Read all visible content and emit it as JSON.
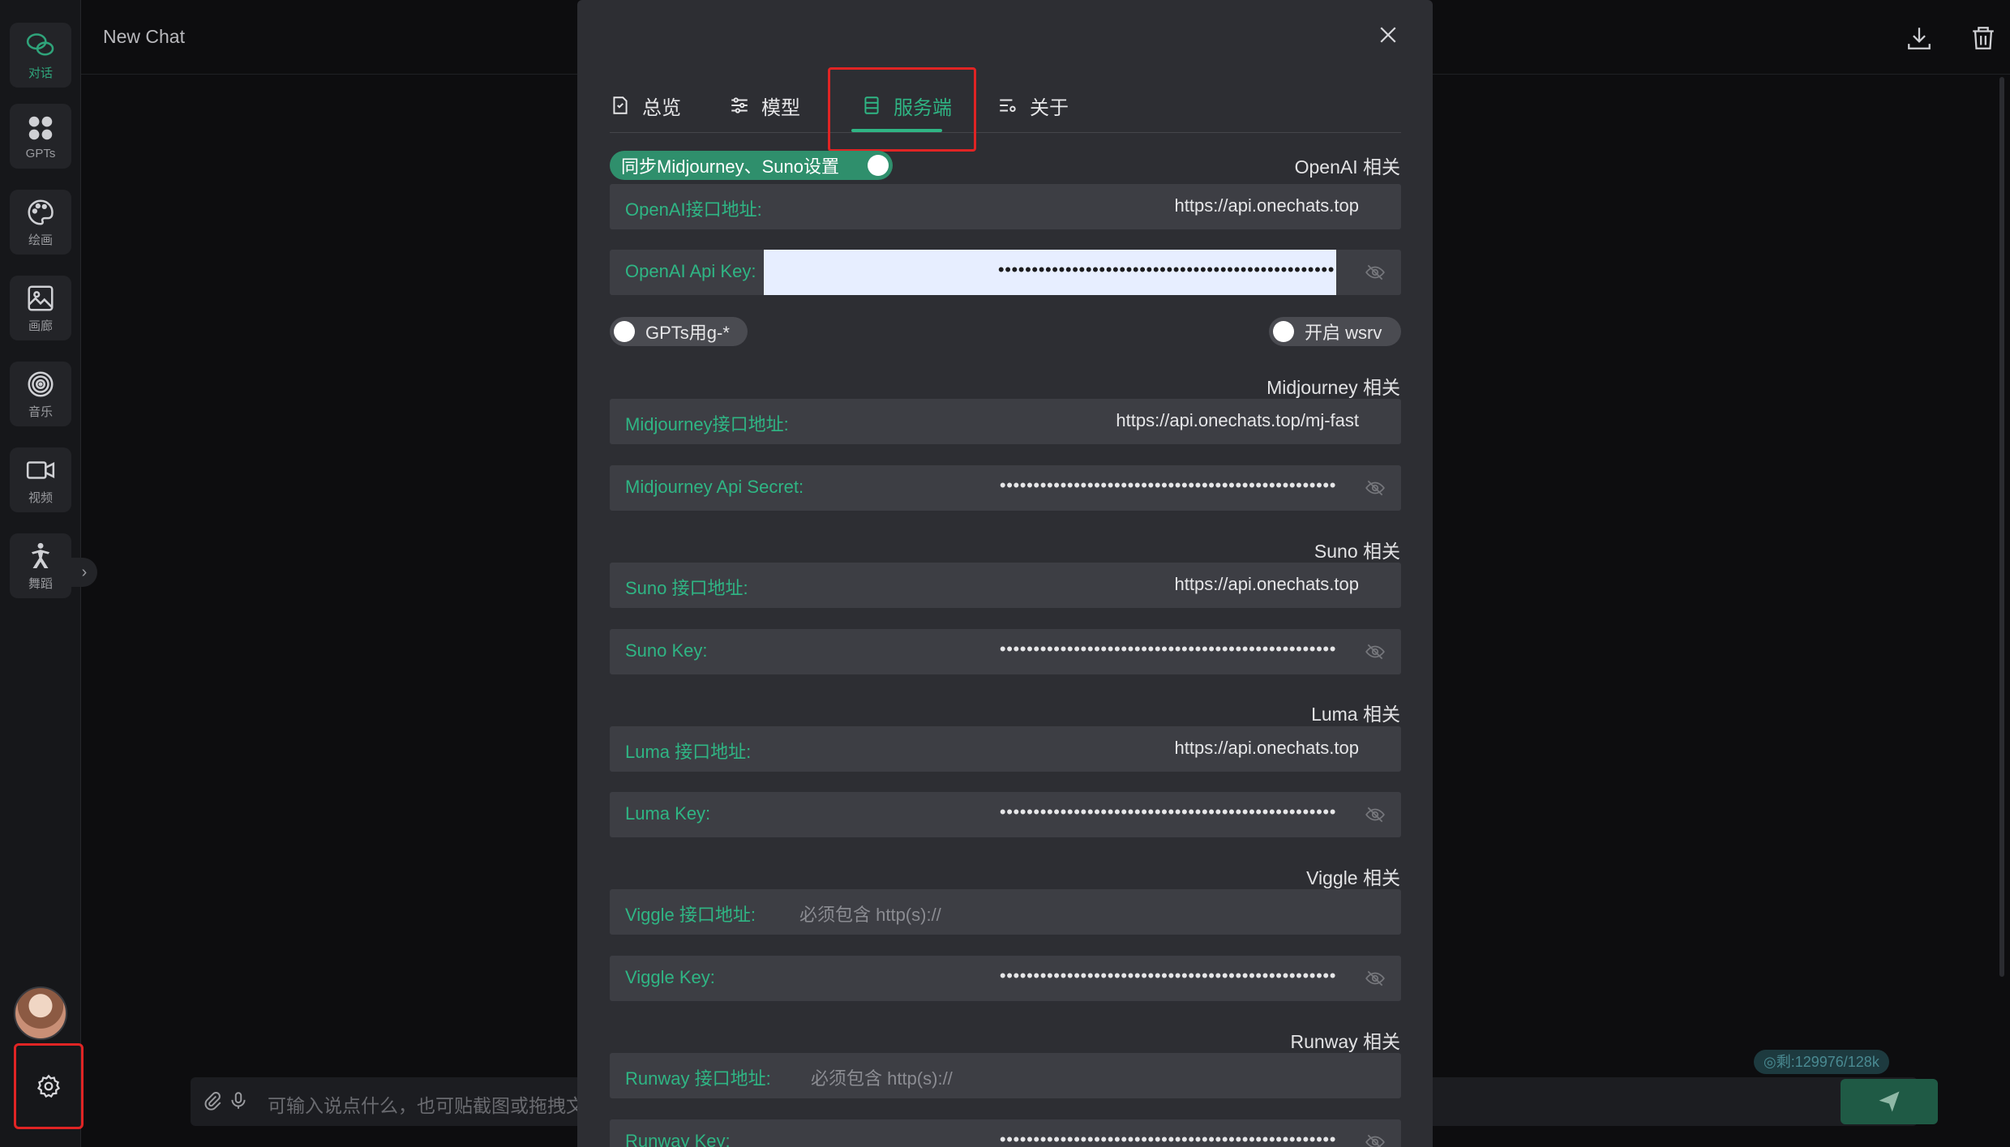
{
  "sidebar": {
    "items": [
      {
        "label": "对话",
        "icon": "chat-icon"
      },
      {
        "label": "GPTs",
        "icon": "apps-icon"
      },
      {
        "label": "绘画",
        "icon": "palette-icon"
      },
      {
        "label": "画廊",
        "icon": "gallery-icon"
      },
      {
        "label": "音乐",
        "icon": "music-icon"
      },
      {
        "label": "视频",
        "icon": "video-icon"
      },
      {
        "label": "舞蹈",
        "icon": "dance-icon"
      }
    ],
    "active_index": 0
  },
  "header": {
    "title": "New Chat"
  },
  "input": {
    "placeholder": "可输入说点什么，也可贴截图或拖拽文",
    "token_badge": "剩:129976/128k"
  },
  "colors": {
    "accent": "#2fb584",
    "highlight_box": "#e02424",
    "modal_bg": "#2d2e33",
    "field_bg": "#3d3e44"
  },
  "modal": {
    "tabs": [
      {
        "label": "总览",
        "icon": "document-icon"
      },
      {
        "label": "模型",
        "icon": "sliders-icon"
      },
      {
        "label": "服务端",
        "icon": "server-icon"
      },
      {
        "label": "关于",
        "icon": "settings-list-icon"
      }
    ],
    "active_tab": "服务端",
    "sync_toggle": {
      "label": "同步Midjourney、Suno设置",
      "on": true
    },
    "gpts_toggle": {
      "label": "GPTs用g-*",
      "on": false
    },
    "wsrv_toggle": {
      "label": "开启 wsrv",
      "on": false
    },
    "sections": {
      "openai": {
        "title": "OpenAI 相关",
        "url_label": "OpenAI接口地址:",
        "url_value": "https://api.onechats.top",
        "key_label": "OpenAI Api Key:",
        "key_mask": "••••••••••••••••••••••••••••••••••••••••••••••••••"
      },
      "midjourney": {
        "title": "Midjourney 相关",
        "url_label": "Midjourney接口地址:",
        "url_value": "https://api.onechats.top/mj-fast",
        "key_label": "Midjourney Api Secret:",
        "key_mask": "••••••••••••••••••••••••••••••••••••••••••••••••••"
      },
      "suno": {
        "title": "Suno 相关",
        "url_label": "Suno 接口地址:",
        "url_value": "https://api.onechats.top",
        "key_label": "Suno Key:",
        "key_mask": "••••••••••••••••••••••••••••••••••••••••••••••••••"
      },
      "luma": {
        "title": "Luma 相关",
        "url_label": "Luma 接口地址:",
        "url_value": "https://api.onechats.top",
        "key_label": "Luma Key:",
        "key_mask": "••••••••••••••••••••••••••••••••••••••••••••••••••"
      },
      "viggle": {
        "title": "Viggle 相关",
        "url_label": "Viggle 接口地址:",
        "url_placeholder": "必须包含 http(s)://",
        "key_label": "Viggle Key:",
        "key_mask": "••••••••••••••••••••••••••••••••••••••••••••••••••"
      },
      "runway": {
        "title": "Runway 相关",
        "url_label": "Runway 接口地址:",
        "url_placeholder": "必须包含 http(s)://",
        "key_label": "Runway Key:",
        "key_mask": "••••••••••••••••••••••••••••••••••••••••••••••••••"
      }
    }
  }
}
